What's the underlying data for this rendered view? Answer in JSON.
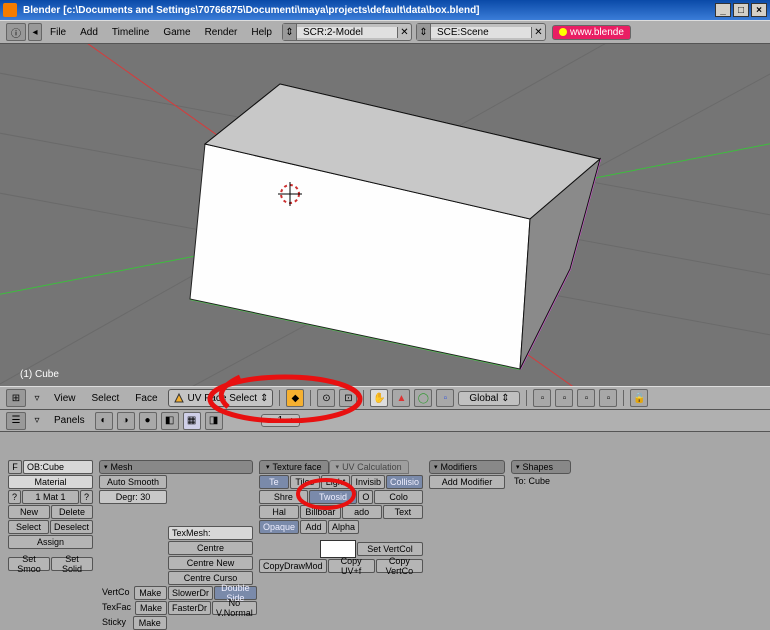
{
  "titlebar": {
    "app": "Blender",
    "path": "[c:\\Documents and Settings\\70766875\\Documenti\\maya\\projects\\default\\data\\box.blend]"
  },
  "menubar": {
    "items": [
      "File",
      "Add",
      "Timeline",
      "Game",
      "Render",
      "Help"
    ],
    "screen": "SCR:2-Model",
    "scene": "SCE:Scene",
    "link": "www.blende"
  },
  "viewport": {
    "object_label": "(1) Cube"
  },
  "header3d": {
    "menus": [
      "View",
      "Select",
      "Face"
    ],
    "mode": "UV Face Select",
    "orientation": "Global"
  },
  "panels_header": {
    "label": "Panels",
    "spin": "1"
  },
  "buttons": {
    "link_obdata": {
      "prefix": "F",
      "value": "OB:Cube"
    },
    "material": "Material",
    "mat_slot": "1 Mat 1",
    "new": "New",
    "delete": "Delete",
    "select": "Select",
    "deselect": "Deselect",
    "assign": "Assign",
    "set_smooth": "Set Smoo",
    "set_solid": "Set Solid",
    "mesh_title": "Mesh",
    "auto_smooth": "Auto Smooth",
    "degr": "Degr: 30",
    "vertcol_label": "VertCo",
    "vertcol_make": "Make",
    "texface_label": "TexFac",
    "texface_make": "Make",
    "sticky_label": "Sticky",
    "sticky_make": "Make",
    "texmesh": "TexMesh:",
    "centre": "Centre",
    "centre_new": "Centre New",
    "centre_cursor": "Centre Curso",
    "slowerdr": "SlowerDr",
    "fasterdr": "FasterDr",
    "double_sided": "Double Side",
    "no_vnormal": "No V.Normal",
    "texface_panel": "Texture face",
    "uvcalc_panel": "UV Calculation",
    "tex": "Te",
    "tiles": "Tiles",
    "light": "Light",
    "invisib": "Invisib",
    "collisio": "Collisio",
    "shared": "Shre",
    "twosid": "Twosid",
    "o": "O",
    "colo": "Colo",
    "halo": "Hal",
    "billboard": "Billboar",
    "ado": "ado",
    "text": "Text",
    "opaque": "Opaque",
    "add": "Add",
    "alpha": "Alpha",
    "set_vertcol": "Set VertCol",
    "copy_drawmode": "CopyDrawMod",
    "copy_uv": "Copy UV+f",
    "copy_vertcol": "Copy VertCo",
    "modifiers": "Modifiers",
    "add_modifier": "Add Modifier",
    "to_cube": "To: Cube",
    "shapes": "Shapes"
  }
}
